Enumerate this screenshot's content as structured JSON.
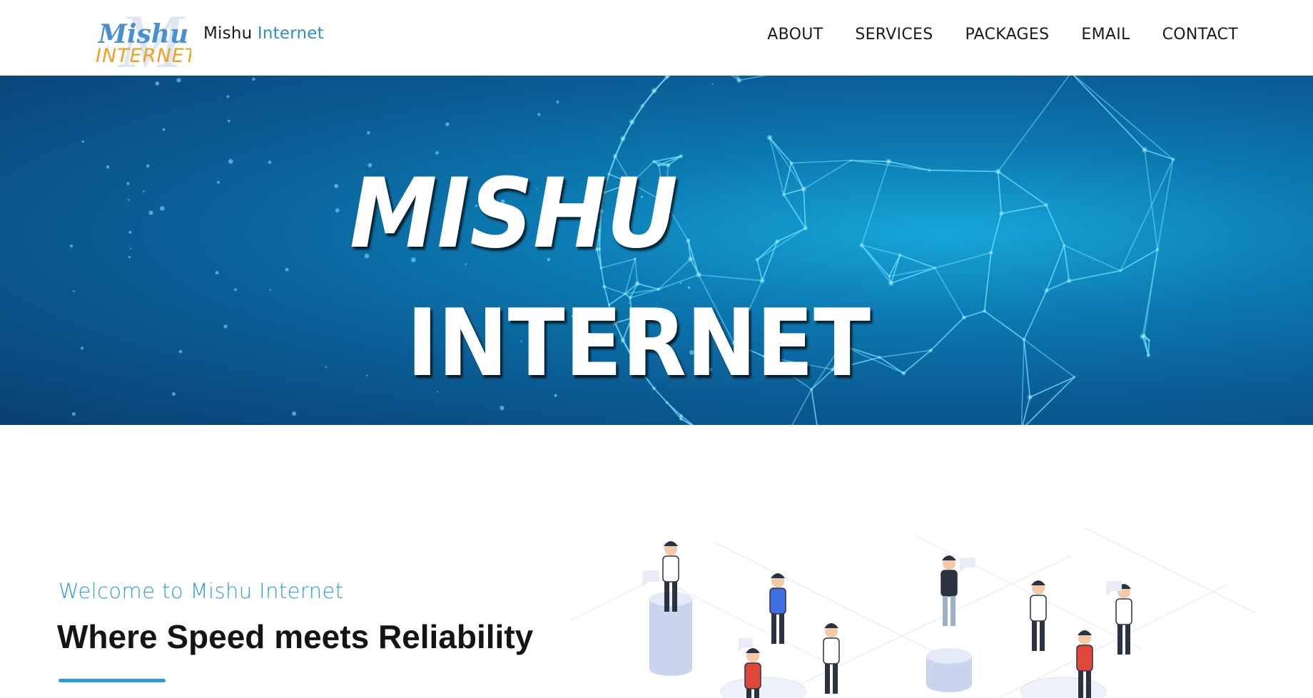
{
  "header": {
    "logo": {
      "script_text": "Mishu",
      "sub_text": "INTERNET",
      "monogram": "M",
      "colors": {
        "script": "#4a8fd0",
        "sub": "#f0a020"
      }
    },
    "brand": {
      "part1": "Mishu",
      "part2": "Internet"
    },
    "nav": [
      {
        "label": "ABOUT"
      },
      {
        "label": "SERVICES"
      },
      {
        "label": "PACKAGES"
      },
      {
        "label": "EMAIL"
      },
      {
        "label": "CONTACT"
      }
    ]
  },
  "hero": {
    "title_line1": "MISHU",
    "title_line2": "INTERNET",
    "colors": {
      "bg_light": "#16a6d8",
      "bg_dark": "#0a3f72",
      "network": "#6fe0ff"
    }
  },
  "intro": {
    "welcome": "Welcome to Mishu Internet",
    "tagline": "Where Speed meets Reliability"
  },
  "illustration": {
    "icon": "team-network-illustration-icon"
  },
  "colors": {
    "accent": "#2a9fd8",
    "text_dark": "#141414"
  }
}
